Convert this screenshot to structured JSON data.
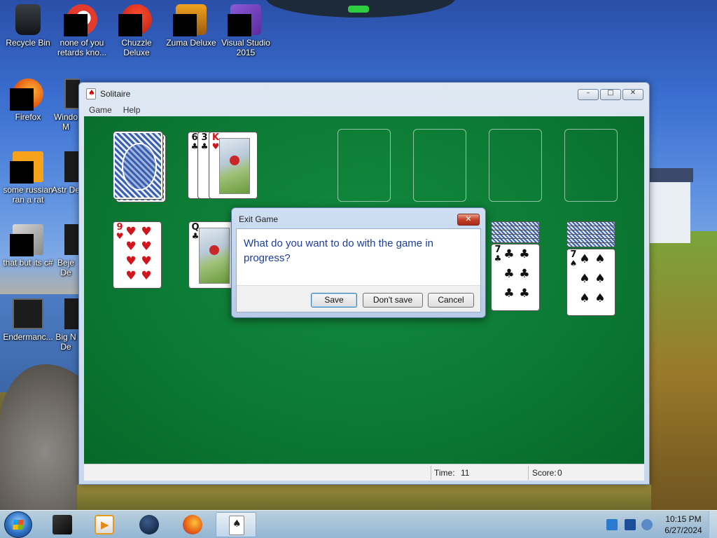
{
  "desktop": {
    "icons": [
      {
        "label": "Recycle Bin",
        "name": "recycle-bin-icon"
      },
      {
        "label": "none of you retards kno...",
        "name": "game-icon"
      },
      {
        "label": "Chuzzle Deluxe",
        "name": "chuzzle-icon"
      },
      {
        "label": "Zuma Deluxe",
        "name": "zuma-icon"
      },
      {
        "label": "Visual Studio 2015",
        "name": "visual-studio-icon"
      },
      {
        "label": "Firefox",
        "name": "firefox-icon"
      },
      {
        "label": "Windo M",
        "name": "windows-media-icon"
      },
      {
        "label": "some russian ran a rat",
        "name": "e-icon"
      },
      {
        "label": "Astr De",
        "name": "astro-icon"
      },
      {
        "label": "that but its c#",
        "name": "stacked-windows-icon"
      },
      {
        "label": "Beje De",
        "name": "bejeweled-icon"
      },
      {
        "label": "Endermanc...",
        "name": "monitor-icon"
      },
      {
        "label": "Big N De",
        "name": "big-game-icon"
      }
    ]
  },
  "window": {
    "title": "Solitaire",
    "menu": [
      "Game",
      "Help"
    ],
    "caption": {
      "minimize": "–",
      "maximize": "□",
      "close": "✕"
    }
  },
  "game": {
    "waste_cards": [
      {
        "rank": "6",
        "suit": "♣",
        "color": "#111111"
      },
      {
        "rank": "3",
        "suit": "♣",
        "color": "#111111"
      },
      {
        "rank": "K",
        "suit": "♥",
        "color": "#d0161c"
      }
    ],
    "tableau": [
      {
        "rank": "9",
        "suit": "♥",
        "color": "#d0161c",
        "pips": [
          "♥",
          "♥",
          "♥",
          "♥",
          "♥",
          "♥",
          "♥",
          "♥",
          "♥"
        ]
      },
      {
        "rank": "Q",
        "suit": "♣",
        "color": "#111111"
      },
      {
        "rank": "7",
        "suit": "♣",
        "color": "#111111",
        "pips": [
          "♣",
          "♣",
          "♣",
          "♣",
          "♣",
          "♣",
          "♣"
        ]
      },
      {
        "rank": "7",
        "suit": "♠",
        "color": "#111111",
        "pips": [
          "♠",
          "♠",
          "♠",
          "♠",
          "♠",
          "♠",
          "♠"
        ]
      }
    ]
  },
  "status": {
    "time_label": "Time:",
    "time_value": "11",
    "score_label": "Score:",
    "score_value": "0"
  },
  "dialog": {
    "title": "Exit Game",
    "close": "✕",
    "question": "What do you want to do with the game in progress?",
    "buttons": {
      "save": "Save",
      "dont_save": "Don't save",
      "cancel": "Cancel"
    }
  },
  "taskbar": {
    "clock_time": "10:15 PM",
    "clock_date": "6/27/2024"
  },
  "colors": {
    "felt": "#0c7a34",
    "dialog_text": "#1c3d9e",
    "card_red": "#d0161c"
  }
}
